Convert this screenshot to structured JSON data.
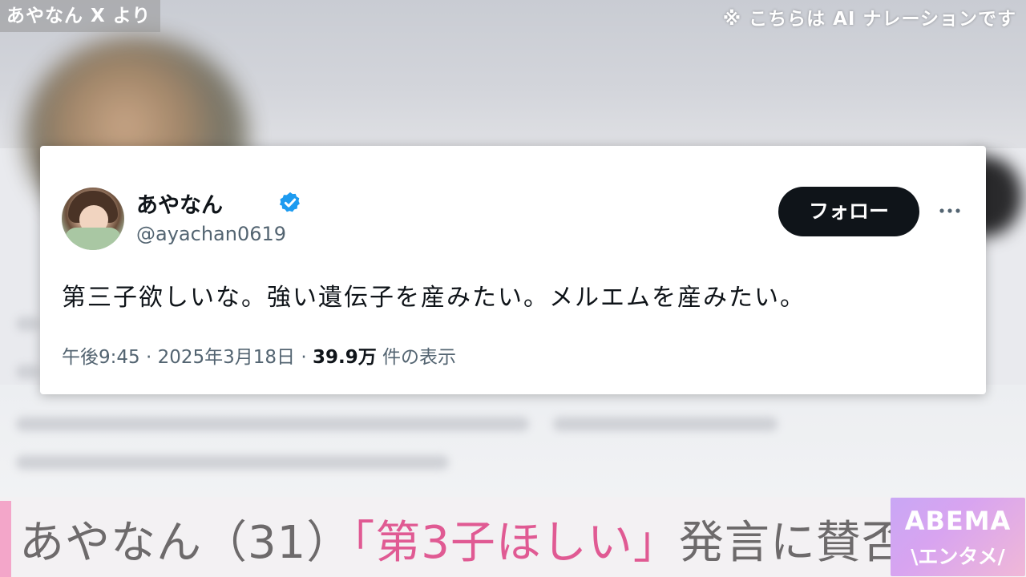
{
  "overlay": {
    "source_label": "あやなん X より",
    "ai_note": "※ こちらは AI ナレーションです"
  },
  "tweet": {
    "display_name": "あやなん",
    "handle": "@ayachan0619",
    "follow_label": "フォロー",
    "text": "第三子欲しいな。強い遺伝子を産みたい。メルエムを産みたい。",
    "time": "午後9:45",
    "date": "2025年3月18日",
    "views_count": "39.9万",
    "views_label": "件の表示",
    "separator": "·",
    "verified_icon": "verified-badge-icon",
    "more_icon": "more-options-icon",
    "colors": {
      "verified": "#1d9bf0",
      "follow_bg": "#0f1419",
      "meta_text": "#536471"
    }
  },
  "caption": {
    "part1": "あやなん（31）",
    "part2": "「第3子ほしい」",
    "part3": "発言に賛否",
    "colors": {
      "gray": "#6d6a6b",
      "pink": "#e05a93",
      "accent": "#f3a6c9"
    }
  },
  "logo": {
    "title": "ABEMA",
    "subtitle": "\\エンタメ/"
  }
}
